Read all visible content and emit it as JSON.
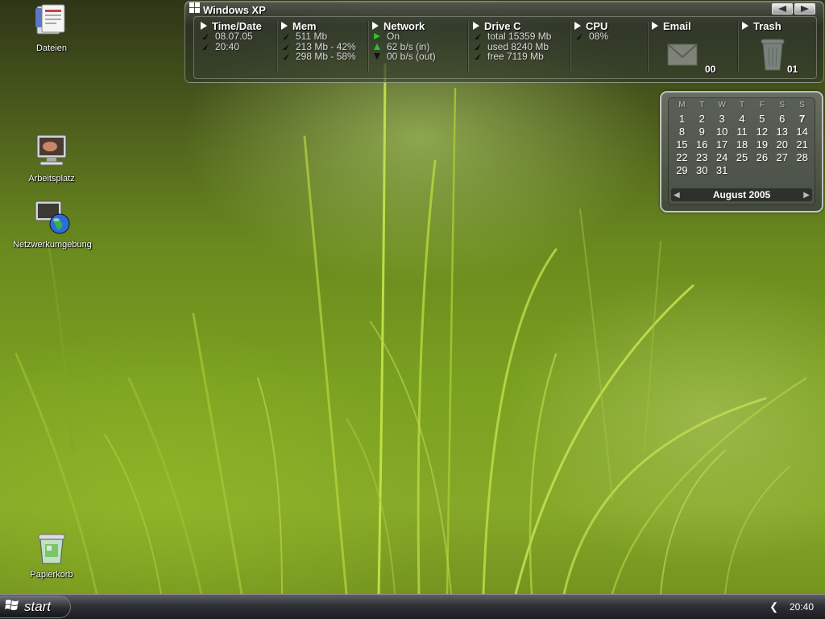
{
  "desktop": {
    "icons": [
      {
        "label": "Dateien"
      },
      {
        "label": "Arbeitsplatz"
      },
      {
        "label": "Netzwerkumgebung"
      },
      {
        "label": "Papierkorb"
      }
    ]
  },
  "sysbar": {
    "title": "Windows XP",
    "sections": {
      "time": {
        "name": "Time/Date",
        "rows": [
          "08.07.05",
          "20:40"
        ]
      },
      "mem": {
        "name": "Mem",
        "rows": [
          "511 Mb",
          "213 Mb - 42%",
          "298 Mb - 58%"
        ]
      },
      "network": {
        "name": "Network",
        "rows": [
          "On",
          "62 b/s (in)",
          "00 b/s (out)"
        ]
      },
      "drive": {
        "name": "Drive C",
        "rows": [
          "total 15359 Mb",
          "used 8240 Mb",
          "free 7119 Mb"
        ]
      },
      "cpu": {
        "name": "CPU",
        "rows": [
          "08%"
        ]
      },
      "email": {
        "name": "Email",
        "count": "00"
      },
      "trash": {
        "name": "Trash",
        "count": "01"
      }
    }
  },
  "calendar": {
    "weekdays": [
      "M",
      "T",
      "W",
      "T",
      "F",
      "S",
      "S"
    ],
    "weeks": [
      [
        "1",
        "2",
        "3",
        "4",
        "5",
        "6",
        "7"
      ],
      [
        "8",
        "9",
        "10",
        "11",
        "12",
        "13",
        "14"
      ],
      [
        "15",
        "16",
        "17",
        "18",
        "19",
        "20",
        "21"
      ],
      [
        "22",
        "23",
        "24",
        "25",
        "26",
        "27",
        "28"
      ],
      [
        "29",
        "30",
        "31",
        "",
        "",
        "",
        ""
      ]
    ],
    "today": "7",
    "month_label": "August 2005"
  },
  "taskbar": {
    "start_label": "start",
    "clock": "20:40"
  },
  "colors": {
    "up_arrow": "#1a1a1a",
    "network_on": "#2fbf2f",
    "network_in": "#2fbf2f"
  }
}
